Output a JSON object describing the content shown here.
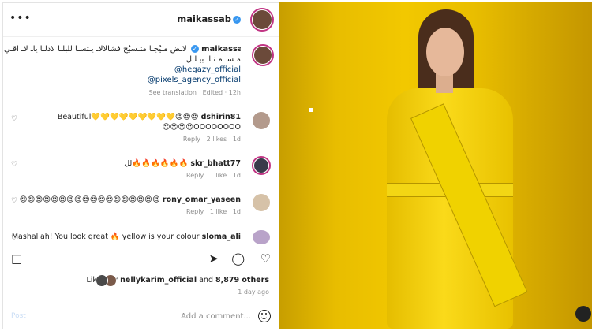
{
  "post": {
    "username": "maikassab",
    "caption_lines": [
      "لاـض مـيُجـا متـسيُج فشالالاـ يـتسـا للبلـا لادلـا ياـ لاـ اقـي",
      "مـسـ مـنـاـ بيـلـل"
    ],
    "mentions": [
      "@hegazy_official",
      "@pixels_agency_official"
    ],
    "edited": "Edited · 12h",
    "see_translation": "See translation"
  },
  "comments": [
    {
      "user": "dshirin81",
      "text": "Beautiful💛💛💛💛💛💛💛💛💛😍😍😍",
      "text2": "😍😍😍😍OOOOOOOO",
      "time": "1d",
      "likes": "2 likes",
      "reply": "Reply"
    },
    {
      "user": "skr_bhatt77",
      "text": "لل🔥🔥🔥🔥🔥🔥",
      "time": "1d",
      "likes": "1 like",
      "reply": "Reply"
    },
    {
      "user": "rony_omar_yaseen",
      "text": "😍😍😍😍😍😍😍😍😍😍😍😍😍😍😍😍😍😍",
      "time": "1d",
      "likes": "1 like",
      "reply": "Reply"
    },
    {
      "user": "sloma_ali",
      "text": "Mashallah! You look great 🔥 yellow is your colour"
    }
  ],
  "liked_by": {
    "prefix": "Liked by ",
    "user": "nellykarim_official",
    "mid": " and ",
    "count": "8,879 others"
  },
  "ago": "1 day ago",
  "add_comment": {
    "placeholder": "Add a comment...",
    "post": "Post"
  },
  "icons": [
    "more-icon",
    "heart-icon",
    "comment-icon",
    "share-icon",
    "bookmark-icon",
    "emoji-icon"
  ],
  "colors": {
    "verified": "#3897f0",
    "ring": "#c13584",
    "photo_bg": "#f2c800"
  }
}
